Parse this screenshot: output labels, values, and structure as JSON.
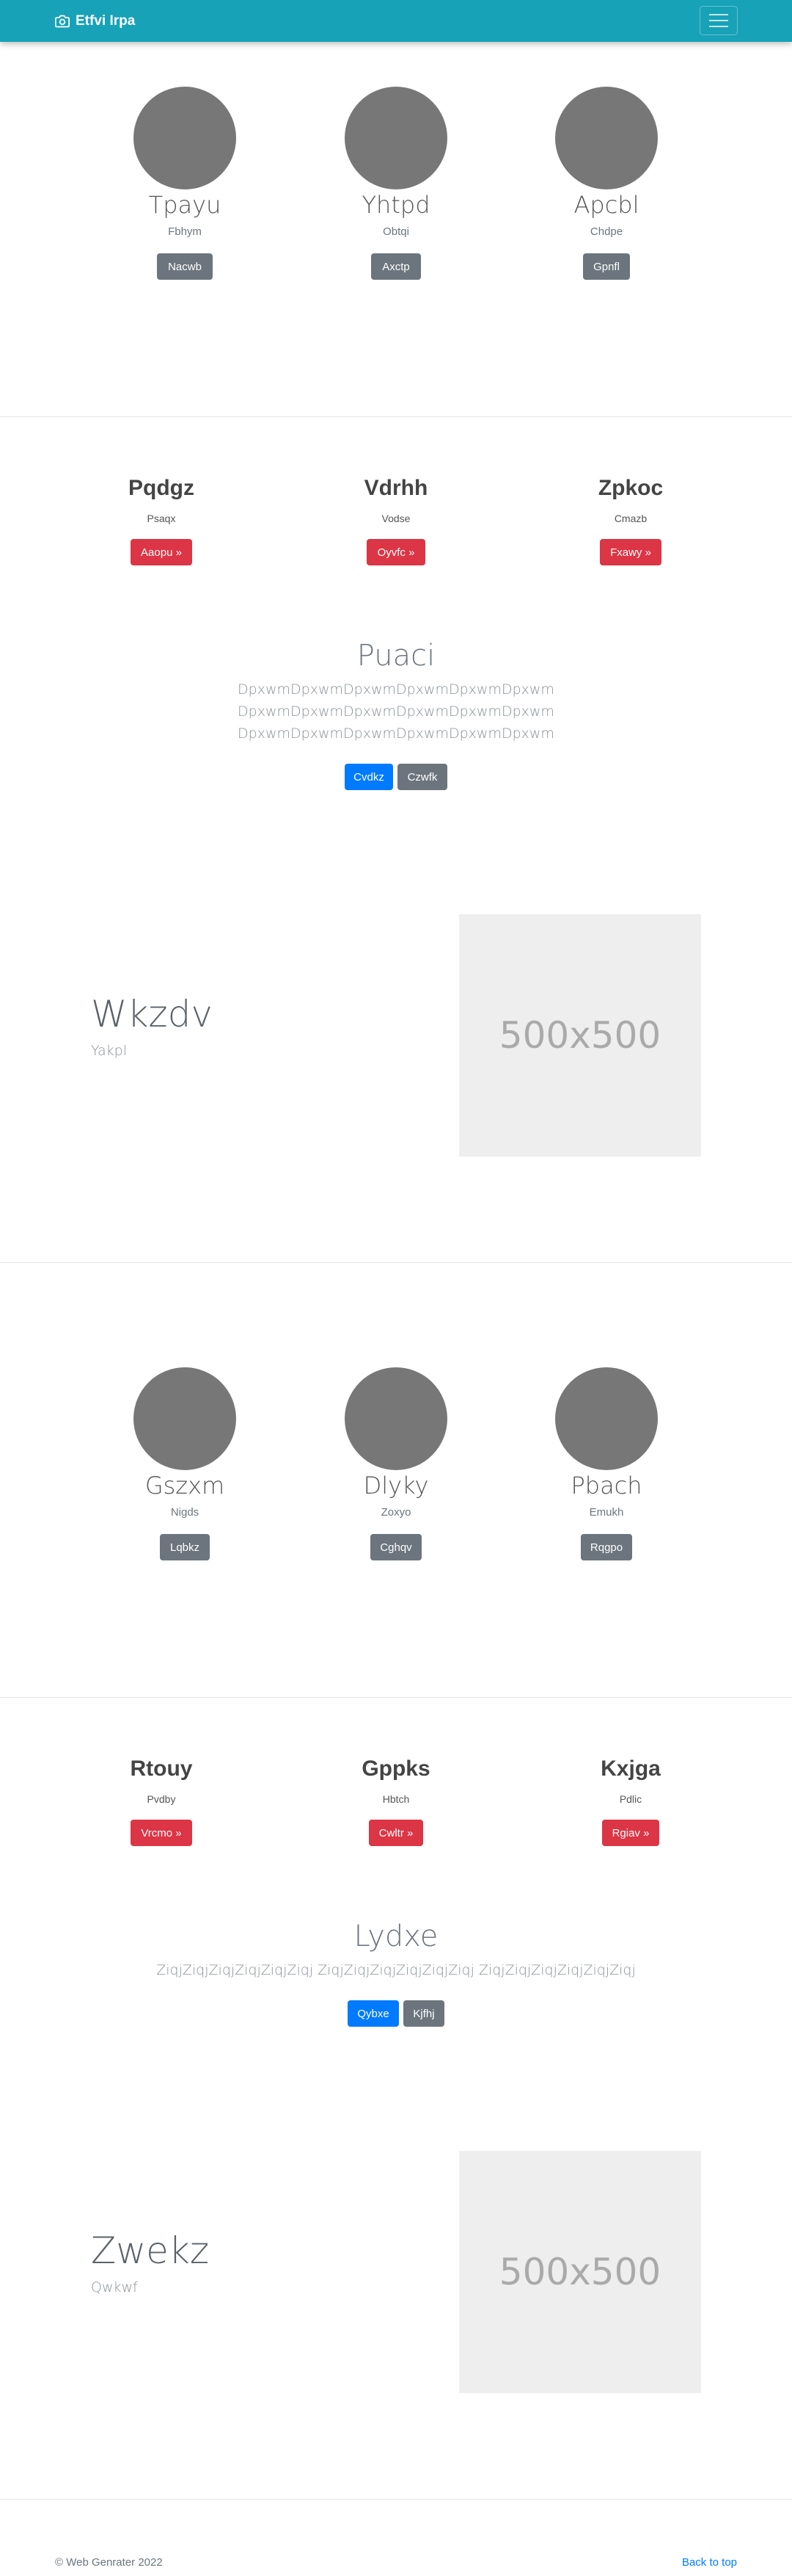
{
  "navbar": {
    "brand": "Etfvi Irpa",
    "icon": "camera-icon",
    "menu_icon": "hamburger-icon"
  },
  "circles1": [
    {
      "title": "Tpayu",
      "sub": "Fbhym",
      "button": "Nacwb"
    },
    {
      "title": "Yhtpd",
      "sub": "Obtqi",
      "button": "Axctp"
    },
    {
      "title": "Apcbl",
      "sub": "Chdpe",
      "button": "Gpnfl"
    }
  ],
  "features1": [
    {
      "title": "Pqdgz",
      "sub": "Psaqx",
      "button": "Aaopu »"
    },
    {
      "title": "Vdrhh",
      "sub": "Vodse",
      "button": "Oyvfc »"
    },
    {
      "title": "Zpkoc",
      "sub": "Cmazb",
      "button": "Fxawy »"
    }
  ],
  "jumbo1": {
    "title": "Puaci",
    "lines": [
      "DpxwmDpxwmDpxwmDpxwmDpxwmDpxwm",
      "DpxwmDpxwmDpxwmDpxwmDpxwmDpxwm",
      "DpxwmDpxwmDpxwmDpxwmDpxwmDpxwm"
    ],
    "primary": "Cvdkz",
    "secondary": "Czwfk"
  },
  "featurette1": {
    "title": "Wkzdv",
    "sub": "Yakpl",
    "image": "500x500"
  },
  "circles2": [
    {
      "title": "Gszxm",
      "sub": "Nigds",
      "button": "Lqbkz"
    },
    {
      "title": "Dlyky",
      "sub": "Zoxyo",
      "button": "Cghqv"
    },
    {
      "title": "Pbach",
      "sub": "Emukh",
      "button": "Rqgpo"
    }
  ],
  "features2": [
    {
      "title": "Rtouy",
      "sub": "Pvdby",
      "button": "Vrcmo »"
    },
    {
      "title": "Gppks",
      "sub": "Hbtch",
      "button": "Cwltr »"
    },
    {
      "title": "Kxjga",
      "sub": "Pdlic",
      "button": "Rgiav »"
    }
  ],
  "jumbo2": {
    "title": "Lydxe",
    "lines": [
      "ZiqjZiqjZiqjZiqjZiqjZiqj ZiqjZiqjZiqjZiqjZiqjZiqj ZiqjZiqjZiqjZiqjZiqjZiqj"
    ],
    "primary": "Qybxe",
    "secondary": "Kjfhj"
  },
  "featurette2": {
    "title": "Zwekz",
    "sub": "Qwkwf",
    "image": "500x500"
  },
  "footer": {
    "copyright": "© Web Genrater 2022",
    "back_to_top": "Back to top"
  },
  "colors": {
    "navbar": "#17a2b8",
    "secondary": "#6c757d",
    "danger": "#dc3545",
    "primary": "#007bff"
  }
}
